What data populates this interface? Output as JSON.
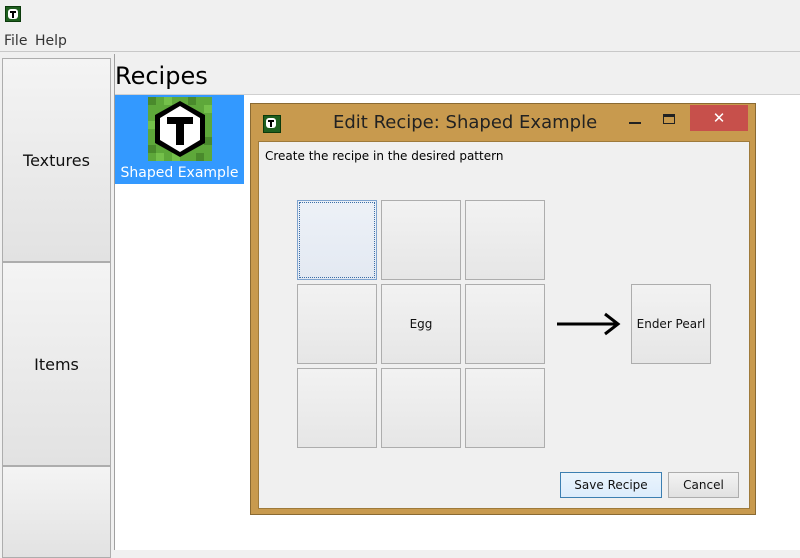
{
  "menu": {
    "file": "File",
    "help": "Help"
  },
  "nav": {
    "textures": "Textures",
    "items": "Items"
  },
  "recipes": {
    "title": "Recipes",
    "tiles": [
      {
        "label": "Shaped Example",
        "icon": "t-logo-icon"
      }
    ]
  },
  "dialog": {
    "title": "Edit Recipe: Shaped Example",
    "close_label": "✕",
    "instruction": "Create the recipe in the desired pattern",
    "grid": [
      "",
      "",
      "",
      "",
      "Egg",
      "",
      "",
      "",
      ""
    ],
    "result": "Ender Pearl",
    "save_label": "Save Recipe",
    "cancel_label": "Cancel"
  },
  "colors": {
    "selection": "#3399ff",
    "dialog_frame": "#c89a4e",
    "close": "#c7504b"
  }
}
